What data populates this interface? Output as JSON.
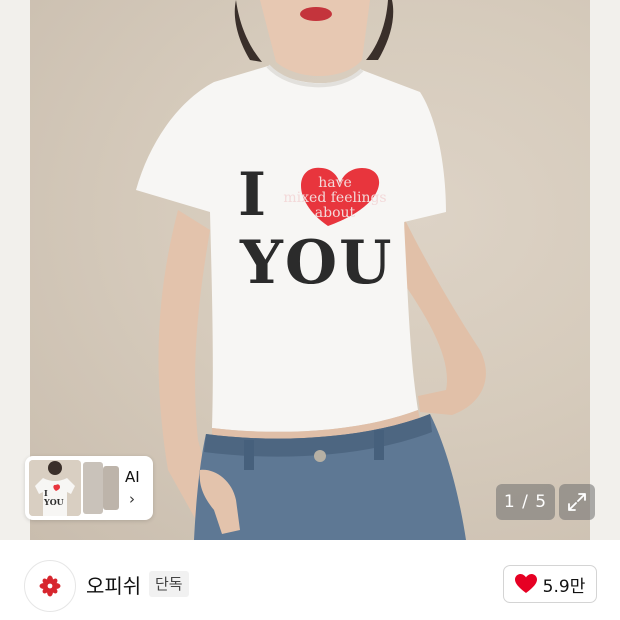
{
  "gallery": {
    "tshirt_print": {
      "main_left": "I",
      "phrase_lines": [
        "have",
        "mixed feelings",
        "about"
      ],
      "main_right": "YOU"
    },
    "thumbnail": {
      "ai_label": "AI",
      "chevron": "›"
    },
    "pager": {
      "current": "1",
      "separator": "/",
      "total": "5",
      "text": "1 / 5"
    },
    "expand_icon": "expand-icon"
  },
  "seller": {
    "name": "오피쉬",
    "badge": "단독",
    "logo_icon": "flower-logo-icon"
  },
  "like": {
    "count": "5.9만",
    "icon": "heart-icon",
    "icon_color": "#e60023"
  },
  "colors": {
    "heart_red": "#e60023",
    "tshirt_white": "#f7f6f4",
    "jeans_blue": "#5e7894"
  }
}
